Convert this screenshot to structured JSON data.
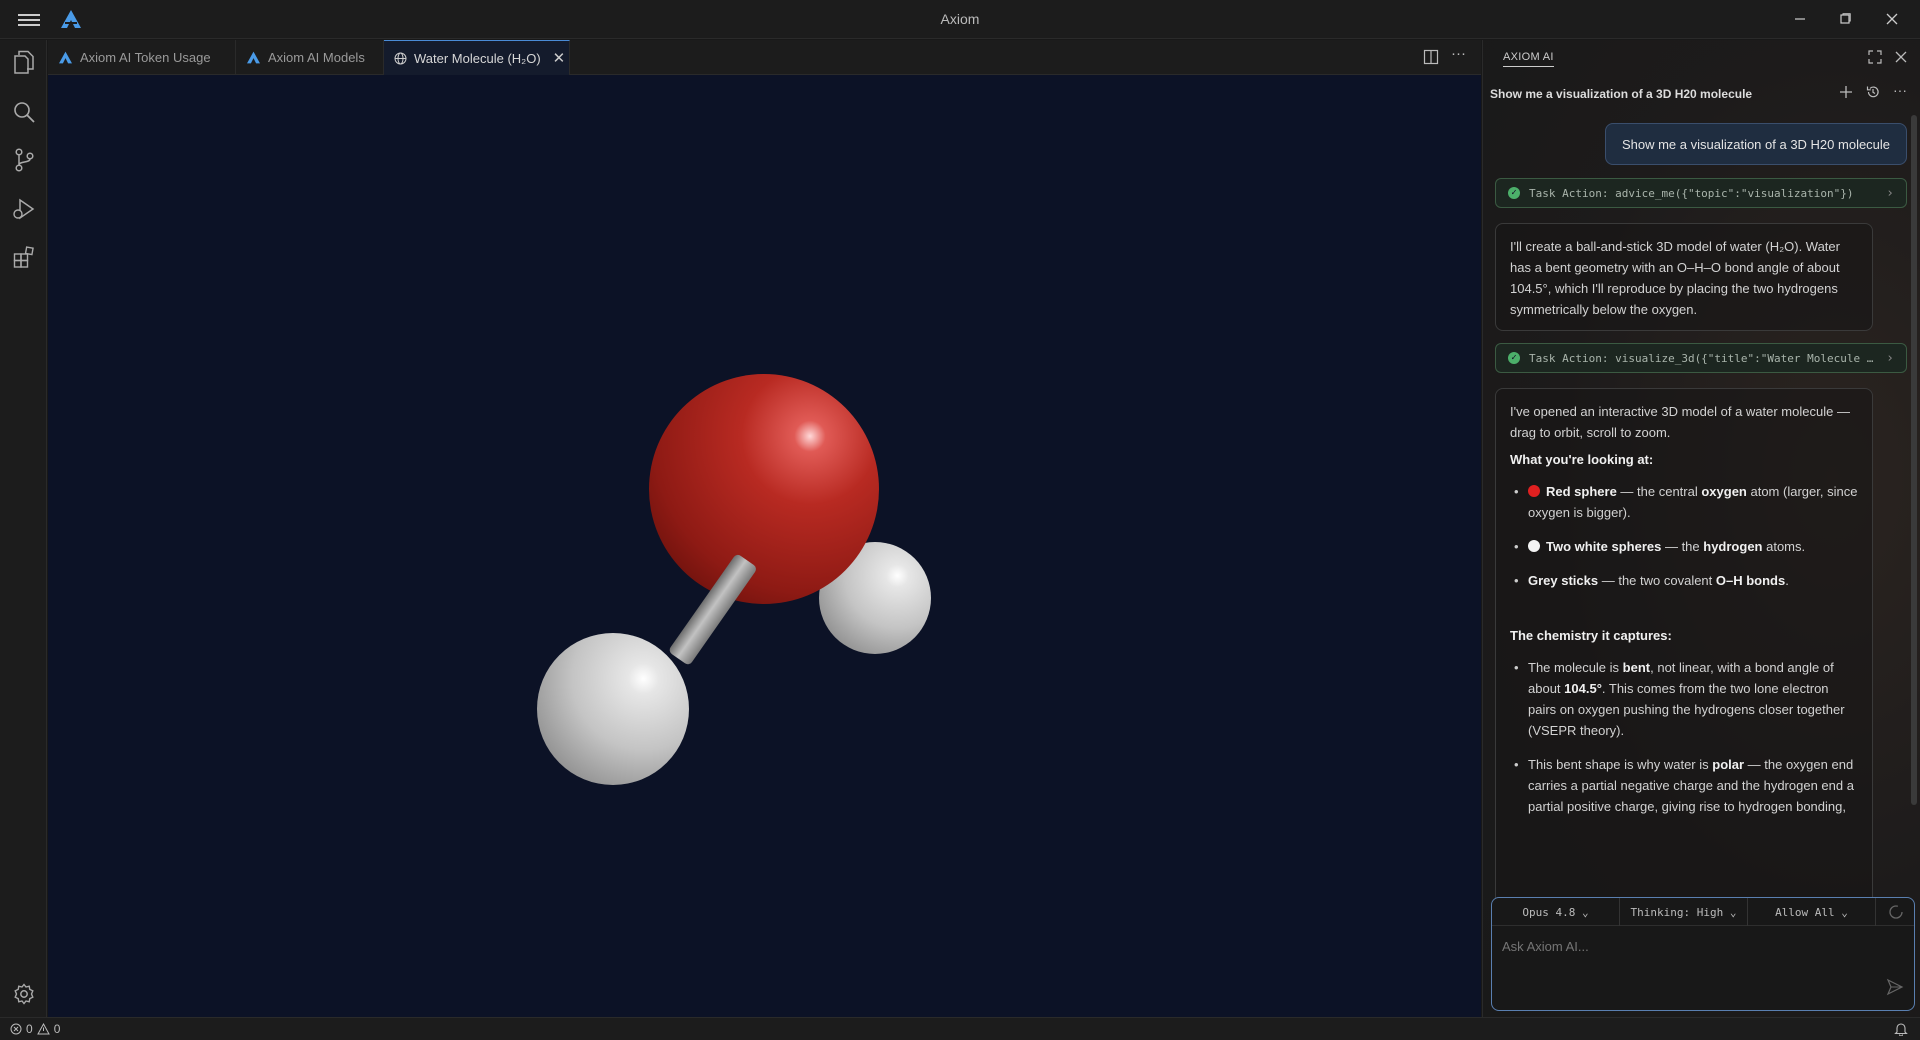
{
  "window": {
    "title": "Axiom"
  },
  "tabs": [
    {
      "label": "Axiom AI Token Usage"
    },
    {
      "label": "Axiom AI Models"
    },
    {
      "label": "Water Molecule (H₂O)"
    }
  ],
  "chat": {
    "panel_label": "AXIOM AI",
    "conversation_title": "Show me a visualization of a 3D H20 molecule",
    "user_message": "Show me a visualization of a 3D H20 molecule",
    "task1": "Task Action: advice_me({\"topic\":\"visualization\"})",
    "reply1": "I'll create a ball-and-stick 3D model of water (H₂O). Water has a bent geometry with an O–H–O bond angle of about 104.5°, which I'll reproduce by placing the two hydrogens symmetrically below the oxygen.",
    "task2": "Task Action: visualize_3d({\"title\":\"Water Molecule …",
    "reply2": {
      "intro": "I've opened an interactive 3D model of a water molecule — drag to orbit, scroll to zoom.",
      "heading1": "What you're looking at:",
      "b1_strong": "Red sphere",
      "b1_mid": " — the central ",
      "b1_strong2": "oxygen",
      "b1_tail": " atom (larger, since oxygen is bigger).",
      "b2_strong": "Two white spheres",
      "b2_mid": " — the ",
      "b2_strong2": "hydrogen",
      "b2_tail": " atoms.",
      "b3_strong": "Grey sticks",
      "b3_mid": " — the two covalent ",
      "b3_strong2": "O–H bonds",
      "b3_tail": ".",
      "heading2": "The chemistry it captures:",
      "c1_a": "The molecule is ",
      "c1_b": "bent",
      "c1_c": ", not linear, with a bond angle of about ",
      "c1_d": "104.5°",
      "c1_e": ". This comes from the two lone electron pairs on oxygen pushing the hydrogens closer together (VSEPR theory).",
      "c2_a": "This bent shape is why water is ",
      "c2_b": "polar",
      "c2_c": " — the oxygen end carries a partial negative charge and the hydrogen end a partial positive charge, giving rise to hydrogen bonding,"
    },
    "options": {
      "model": "Opus 4.8",
      "thinking": "Thinking: High",
      "permissions": "Allow All"
    },
    "input_placeholder": "Ask Axiom AI..."
  },
  "status": {
    "errors": "0",
    "warnings": "0"
  },
  "colors": {
    "oxygen": "#c0241c",
    "hydrogen": "#d8d8d8",
    "bond": "#9a9a9a",
    "viewport_bg": "#0c1226",
    "accent": "#4a8bd6"
  }
}
